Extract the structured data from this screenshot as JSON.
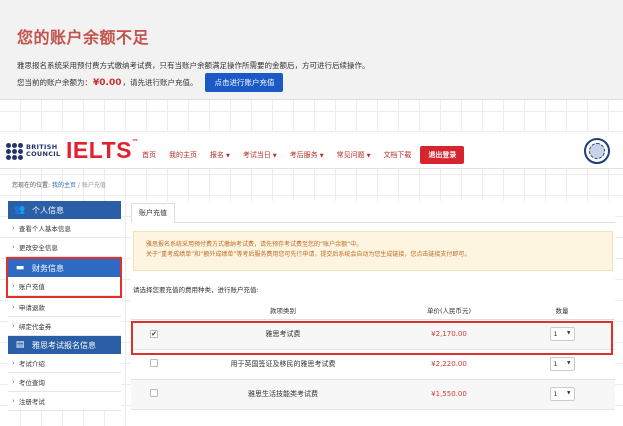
{
  "alert": {
    "title": "您的账户余额不足",
    "message": "雅思报名系统采用预付费方式缴纳考试费，只有当账户余额满足操作所需要的金额后，方可进行后续操作。",
    "balance_prefix": "您当前的账户余额为：",
    "balance_amount": "¥0.00",
    "balance_suffix": "，请先进行账户充值。",
    "recharge_button": "点击进行账户充值"
  },
  "header": {
    "bc_line1": "BRITISH",
    "bc_line2": "COUNCIL",
    "ielts_logo": "IELTS",
    "ielts_tm": "™",
    "nav": [
      {
        "label": "首页",
        "has_caret": false
      },
      {
        "label": "我的主页",
        "has_caret": false
      },
      {
        "label": "报名",
        "has_caret": true
      },
      {
        "label": "考试当日",
        "has_caret": true
      },
      {
        "label": "考后服务",
        "has_caret": true
      },
      {
        "label": "常见问题",
        "has_caret": true
      },
      {
        "label": "文档下载",
        "has_caret": false
      }
    ],
    "logout_button": "退出登录"
  },
  "breadcrumb": {
    "prefix": "您现在的位置:",
    "home": "我的主页",
    "separator": "/",
    "current": "账户充值"
  },
  "sidebar": {
    "personal_header": "个人信息",
    "personal_items": [
      "查看个人基本信息",
      "更改安全信息"
    ],
    "finance_header": "财务信息",
    "finance_items": [
      "账户充值"
    ],
    "more_items": [
      "申请退款",
      "绑定代金券"
    ],
    "exam_header": "雅思考试报名信息",
    "exam_items": [
      "考试介绍",
      "考位查询",
      "注册考试"
    ]
  },
  "main": {
    "tab_label": "账户充值",
    "notice_line1": "雅思报名系统采用预付费方式缴纳考试费，请先预存考试费至您的“账户余额”中。",
    "notice_line2": "关于“重考成绩单”和“额外成绩单”等考后服务费用您可先行申请，提交后系统会自动为您生成链接，您点击链接支付即可。",
    "choose_label": "请选择您要充值的费用种类，进行账户充值:",
    "columns": [
      "",
      "款项类别",
      "单价(人民币元)",
      "数量"
    ],
    "rows": [
      {
        "checked": true,
        "category": "雅思考试费",
        "price": "¥2,170.00",
        "quantity": "1"
      },
      {
        "checked": false,
        "category": "用于英国签证及移民的雅思考试费",
        "price": "¥2,220.00",
        "quantity": "1"
      },
      {
        "checked": false,
        "category": "雅思生活技能类考试费",
        "price": "¥1,550.00",
        "quantity": "1"
      }
    ]
  },
  "icons": {
    "users": "users-icon",
    "finance": "credit-card-icon",
    "exam": "id-card-icon",
    "caret": "chevron-down-icon",
    "arrow": "chevron-right-icon"
  },
  "colors": {
    "alert_title": "#c2534d",
    "primary_blue": "#1b5ac6",
    "nav_red": "#b52d26",
    "logout_red": "#d7252f",
    "highlight_red": "#e0302a",
    "price_red": "#d23a31",
    "sidebar_blue": "#2a5ea6",
    "notice_bg": "#fdf5e0",
    "notice_text": "#c16a27"
  }
}
